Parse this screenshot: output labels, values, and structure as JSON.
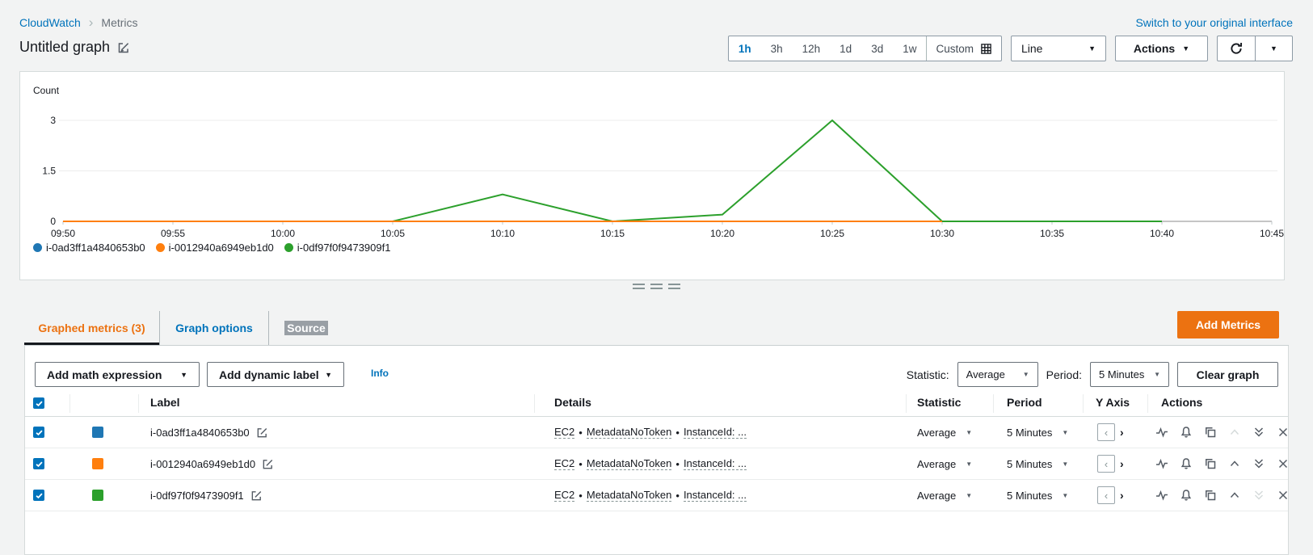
{
  "breadcrumb": {
    "items": [
      {
        "label": "CloudWatch"
      },
      {
        "label": "Metrics"
      }
    ]
  },
  "header": {
    "switch_link": "Switch to your original interface",
    "title": "Untitled graph"
  },
  "icons": {
    "chevron_down": "▼",
    "breadcrumb_chevron": "›",
    "bullet": "•",
    "yaxis_left": "‹",
    "yaxis_right": "›"
  },
  "time_controls": {
    "ranges": [
      "1h",
      "3h",
      "12h",
      "1d",
      "3d",
      "1w"
    ],
    "active_range": "1h",
    "custom_label": "Custom",
    "line_select_value": "Line",
    "actions_label": "Actions"
  },
  "chart_data": {
    "type": "line",
    "title": "Untitled graph",
    "ylabel": "Count",
    "xlabel": "",
    "ylim": [
      0,
      3
    ],
    "yticks": [
      0,
      1.5,
      3
    ],
    "ytick_labels": [
      "0",
      "1.5",
      "3"
    ],
    "grid": true,
    "legend_position": "bottom",
    "x_labels": [
      "09:50",
      "09:55",
      "10:00",
      "10:05",
      "10:10",
      "10:15",
      "10:20",
      "10:25",
      "10:30",
      "10:35",
      "10:40",
      "10:45"
    ],
    "series": [
      {
        "name": "i-0ad3ff1a4840653b0",
        "color": "#1f77b4",
        "values": [
          0,
          0,
          0,
          0,
          0,
          0,
          0,
          0,
          0
        ]
      },
      {
        "name": "i-0012940a6949eb1d0",
        "color": "#ff7f0e",
        "values": [
          0,
          0,
          0,
          0,
          0,
          0,
          0,
          0,
          0
        ]
      },
      {
        "name": "i-0df97f0f9473909f1",
        "color": "#2ca02c",
        "values": [
          0,
          0,
          0,
          0,
          0.8,
          0,
          0.2,
          3,
          0,
          0,
          0
        ]
      }
    ],
    "no_data_axis_segment": {
      "from": "10:40",
      "to": "10:45",
      "color": "#c5c5c5"
    }
  },
  "tabs": [
    {
      "label": "Graphed metrics (3)",
      "active": true
    },
    {
      "label": "Graph options",
      "active": false
    },
    {
      "label": "Source",
      "active": false,
      "text_highlighted": true
    }
  ],
  "add_metrics_label": "Add Metrics",
  "toolbar": {
    "add_math_label": "Add math expression",
    "add_dynamic_label": "Add dynamic label",
    "info_label": "Info",
    "statistic_label": "Statistic:",
    "statistic_value": "Average",
    "period_label": "Period:",
    "period_value": "5 Minutes",
    "clear_graph_label": "Clear graph"
  },
  "metrics_table": {
    "columns": [
      "Label",
      "Details",
      "Statistic",
      "Period",
      "Y Axis",
      "Actions"
    ],
    "details_separator": "•",
    "action_icons": [
      "graph-this-metric",
      "create-alarm",
      "duplicate",
      "move-up",
      "move-down",
      "remove"
    ],
    "rows": [
      {
        "checked": true,
        "color": "#1f77b4",
        "label": "i-0ad3ff1a4840653b0",
        "details_parts": [
          "EC2",
          "MetadataNoToken",
          "InstanceId: ..."
        ],
        "statistic": "Average",
        "period": "5 Minutes",
        "move_up_disabled": true,
        "move_down_disabled": false
      },
      {
        "checked": true,
        "color": "#ff7f0e",
        "label": "i-0012940a6949eb1d0",
        "details_parts": [
          "EC2",
          "MetadataNoToken",
          "InstanceId: ..."
        ],
        "statistic": "Average",
        "period": "5 Minutes",
        "move_up_disabled": false,
        "move_down_disabled": false
      },
      {
        "checked": true,
        "color": "#2ca02c",
        "label": "i-0df97f0f9473909f1",
        "details_parts": [
          "EC2",
          "MetadataNoToken",
          "InstanceId: ..."
        ],
        "statistic": "Average",
        "period": "5 Minutes",
        "move_up_disabled": false,
        "move_down_disabled": true
      }
    ]
  }
}
